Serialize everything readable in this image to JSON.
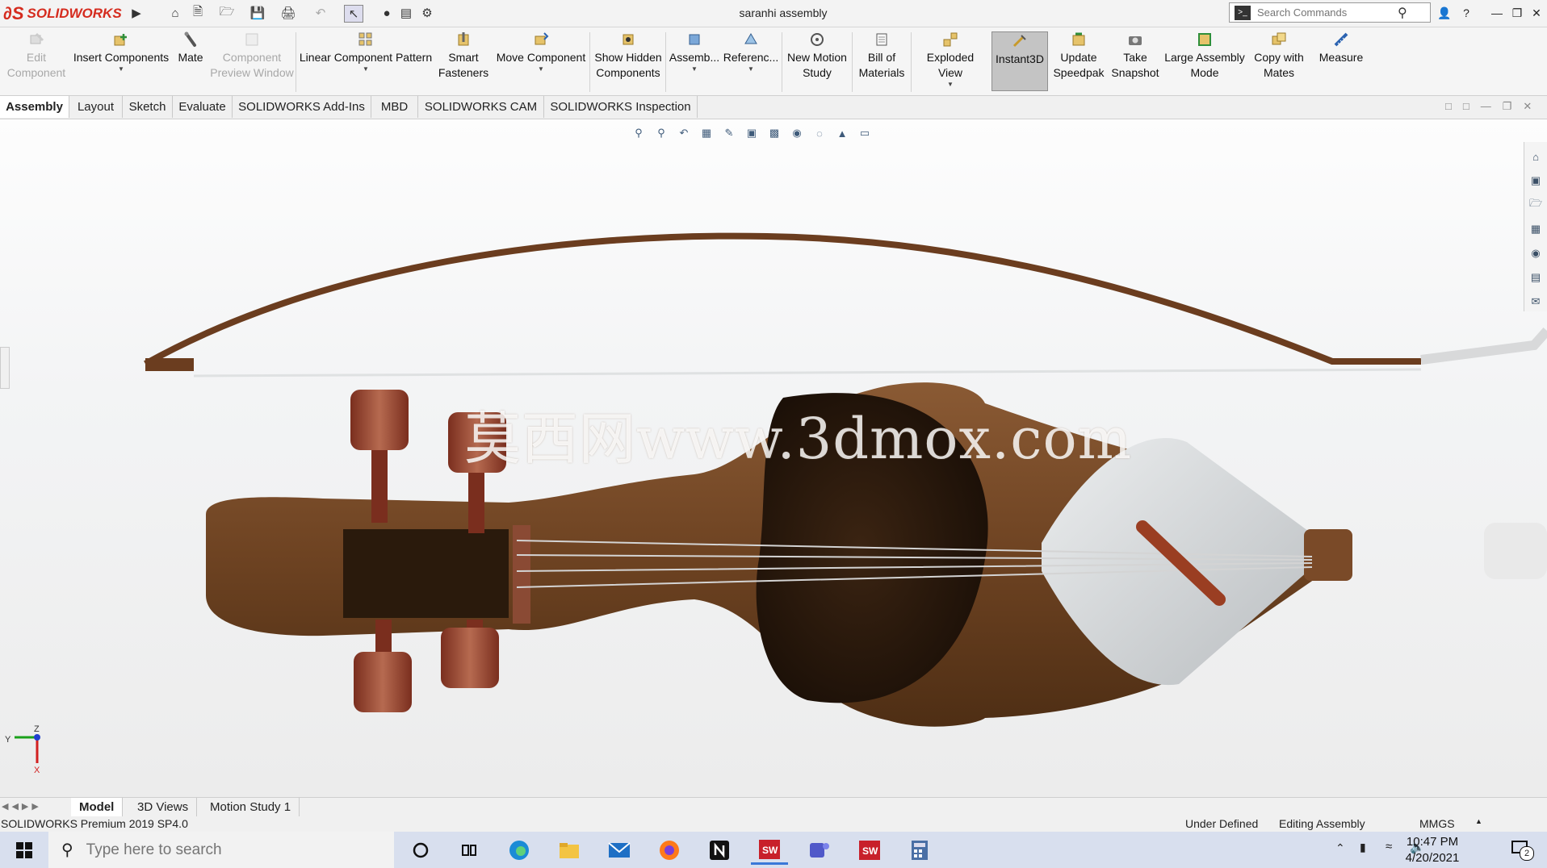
{
  "app": {
    "brand": "SOLIDWORKS",
    "document_title": "saranhi assembly",
    "search_placeholder": "Search Commands"
  },
  "commands": [
    {
      "label": "Edit\nComponent",
      "icon": "edit-component-icon",
      "enabled": false
    },
    {
      "label": "Insert Components",
      "icon": "insert-components-icon",
      "enabled": true
    },
    {
      "label": "Mate",
      "icon": "mate-icon",
      "enabled": true
    },
    {
      "label": "Component\nPreview Window",
      "icon": "component-preview-icon",
      "enabled": false
    },
    {
      "label": "Linear Component Pattern",
      "icon": "linear-pattern-icon",
      "enabled": true
    },
    {
      "label": "Smart\nFasteners",
      "icon": "smart-fasteners-icon",
      "enabled": true
    },
    {
      "label": "Move Component",
      "icon": "move-component-icon",
      "enabled": true
    },
    {
      "label": "Show Hidden\nComponents",
      "icon": "show-hidden-icon",
      "enabled": true
    },
    {
      "label": "Assemb...",
      "icon": "assembly-features-icon",
      "enabled": true
    },
    {
      "label": "Referenc...",
      "icon": "reference-geometry-icon",
      "enabled": true
    },
    {
      "label": "New Motion\nStudy",
      "icon": "motion-study-icon",
      "enabled": true
    },
    {
      "label": "Bill of\nMaterials",
      "icon": "bill-of-materials-icon",
      "enabled": true
    },
    {
      "label": "Exploded View",
      "icon": "exploded-view-icon",
      "enabled": true
    },
    {
      "label": "Instant3D",
      "icon": "instant3d-icon",
      "enabled": true
    },
    {
      "label": "Update\nSpeedpak",
      "icon": "speedpak-icon",
      "enabled": true
    },
    {
      "label": "Take\nSnapshot",
      "icon": "snapshot-icon",
      "enabled": true
    },
    {
      "label": "Large Assembly\nMode",
      "icon": "large-assembly-icon",
      "enabled": true
    },
    {
      "label": "Copy with\nMates",
      "icon": "copy-with-mates-icon",
      "enabled": true
    },
    {
      "label": "Measure",
      "icon": "measure-icon",
      "enabled": true
    }
  ],
  "tabs": [
    "Assembly",
    "Layout",
    "Sketch",
    "Evaluate",
    "SOLIDWORKS Add-Ins",
    "MBD",
    "SOLIDWORKS CAM",
    "SOLIDWORKS Inspection"
  ],
  "active_tab": "Assembly",
  "viewport": {
    "watermark": "莫西网www.3dmox.com",
    "triad": {
      "y": "Y",
      "z": "Z",
      "x": "X"
    }
  },
  "bottom_tabs": [
    "Model",
    "3D Views",
    "Motion Study 1"
  ],
  "status": {
    "version": "SOLIDWORKS Premium 2019 SP4.0",
    "definition": "Under Defined",
    "mode": "Editing Assembly",
    "units": "MMGS"
  },
  "taskbar": {
    "search_placeholder": "Type here to search",
    "time": "10:47 PM",
    "date": "4/20/2021",
    "notifications": "2"
  },
  "colors": {
    "brand_red": "#d52b1e",
    "wood": "#7a4a28",
    "peg": "#a0503a"
  }
}
